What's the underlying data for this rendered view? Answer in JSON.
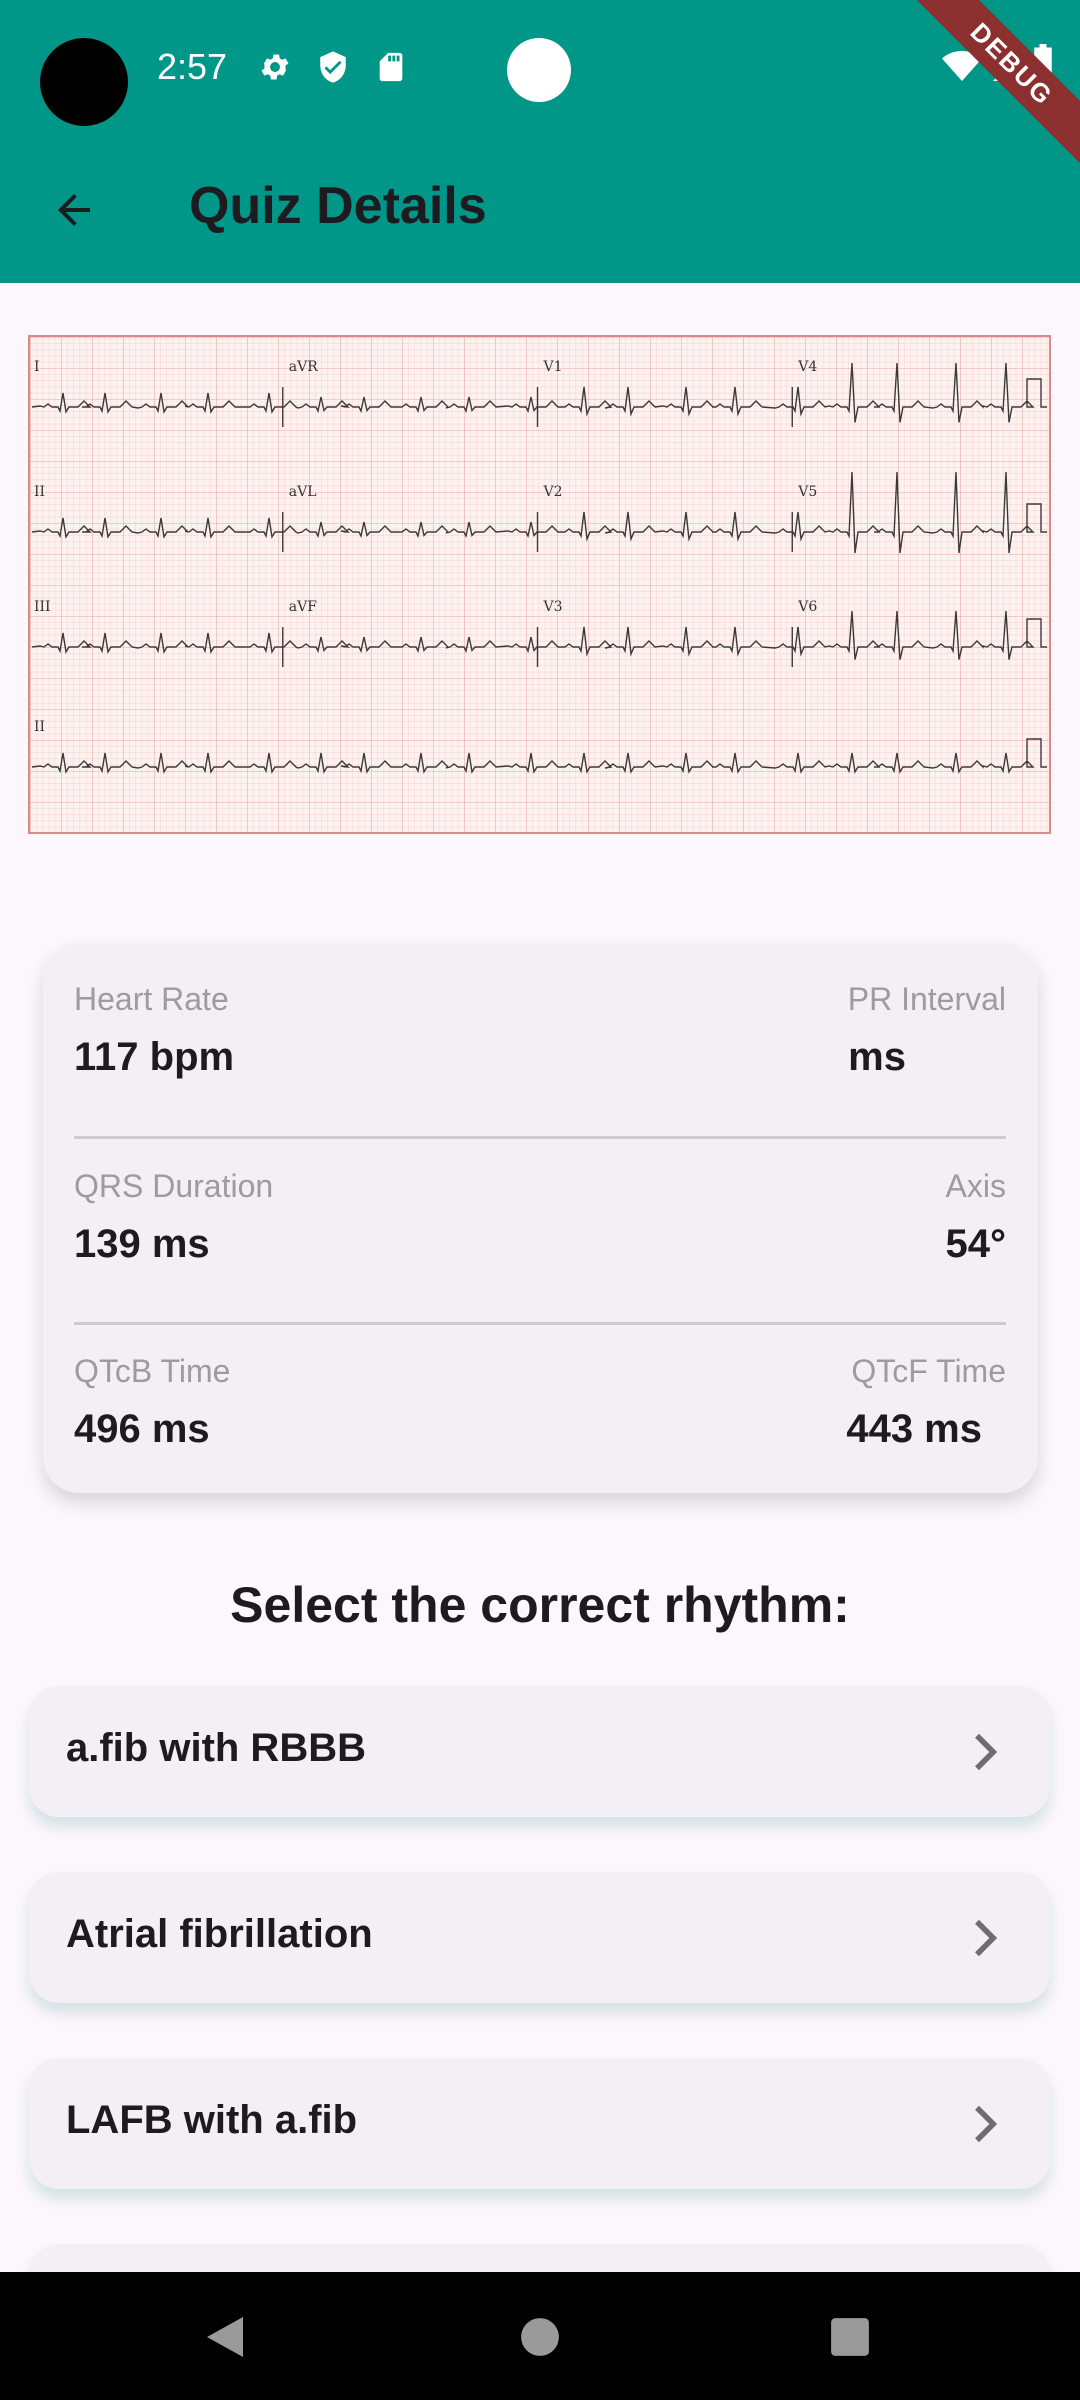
{
  "status_bar": {
    "time": "2:57",
    "icons": [
      "settings-icon",
      "shield-icon",
      "sd-card-icon",
      "wifi-icon",
      "signal-icon",
      "battery-icon"
    ]
  },
  "debug_banner": "DEBUG",
  "app_bar": {
    "title": "Quiz Details",
    "back_icon": "arrow-left-icon"
  },
  "ecg": {
    "lead_labels": [
      "I",
      "aVR",
      "V1",
      "V4",
      "II",
      "aVL",
      "V2",
      "V5",
      "III",
      "aVF",
      "V3",
      "V6",
      "II"
    ]
  },
  "metrics": {
    "heart_rate": {
      "label": "Heart Rate",
      "value": "117 bpm"
    },
    "pr_interval": {
      "label": "PR Interval",
      "value": " ms"
    },
    "qrs_duration": {
      "label": "QRS Duration",
      "value": "139 ms"
    },
    "axis": {
      "label": "Axis",
      "value": "54°"
    },
    "qtcb": {
      "label": "QTcB Time",
      "value": "496 ms"
    },
    "qtcf": {
      "label": "QTcF Time",
      "value": "443 ms"
    }
  },
  "question": {
    "prompt": "Select the correct rhythm:",
    "options": [
      {
        "label": "a.fib with RBBB"
      },
      {
        "label": "Atrial fibrillation"
      },
      {
        "label": "LAFB with a.fib"
      }
    ]
  },
  "colors": {
    "app_bar": "#009688",
    "background": "#fcf7fc",
    "card": "#f4eff4",
    "ecg_grid": "#e6a4a4",
    "debug_ribbon": "#8b2f2f"
  }
}
